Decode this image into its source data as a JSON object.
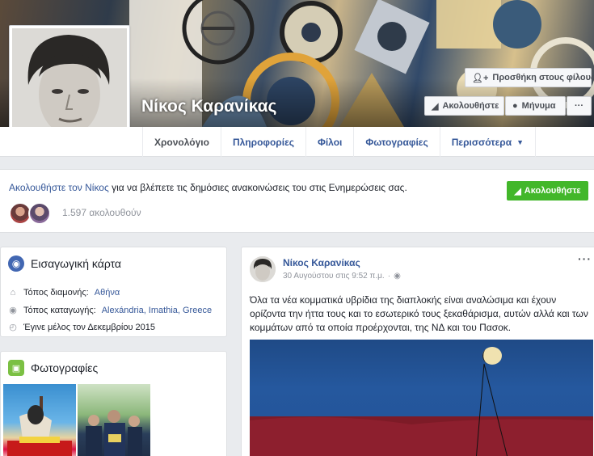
{
  "profile": {
    "name": "Νίκος Καρανίκας"
  },
  "cover_buttons": {
    "add_friend": "Προσθήκη στους φίλους",
    "follow": "Ακολουθήστε",
    "message": "Μήνυμα",
    "more": "···"
  },
  "tabs": [
    {
      "label": "Χρονολόγιο",
      "active": true
    },
    {
      "label": "Πληροφορίες"
    },
    {
      "label": "Φίλοι"
    },
    {
      "label": "Φωτογραφίες"
    },
    {
      "label": "Περισσότερα"
    }
  ],
  "follow_banner": {
    "link_text": "Ακολουθήστε τον Νίκος",
    "rest_text": " για να βλέπετε τις δημόσιες ανακοινώσεις του στις Ενημερώσεις σας.",
    "followers": "1.597 ακολουθούν",
    "follow_button": "Ακολουθήστε",
    "button_color": "#42b72a"
  },
  "intro": {
    "title": "Εισαγωγική κάρτα",
    "lives_label": "Τόπος διαμονής:",
    "lives_value": "Αθήνα",
    "from_label": "Τόπος καταγωγής:",
    "from_value": "Alexándria, Imathia, Greece",
    "joined": "Έγινε μέλος τον Δεκεμβρίου 2015"
  },
  "photos": {
    "title": "Φωτογραφίες"
  },
  "post": {
    "author": "Νίκος Καρανίκας",
    "date": "30 Αυγούστου στις 9:52 π.μ.",
    "privacy_icon": "globe-icon",
    "text": "Όλα τα νέα κομματικά υβρίδια της διαπλοκής είναι αναλώσιμα και έχουν ορίζοντα την ήττα τους και το εσωτερικό τους ξεκαθάρισμα, αυτών αλλά και των κομμάτων από τα οποία προέρχονται, της ΝΔ και του Πασοκ."
  },
  "colors": {
    "link": "#365899",
    "background": "#e9ebee"
  }
}
